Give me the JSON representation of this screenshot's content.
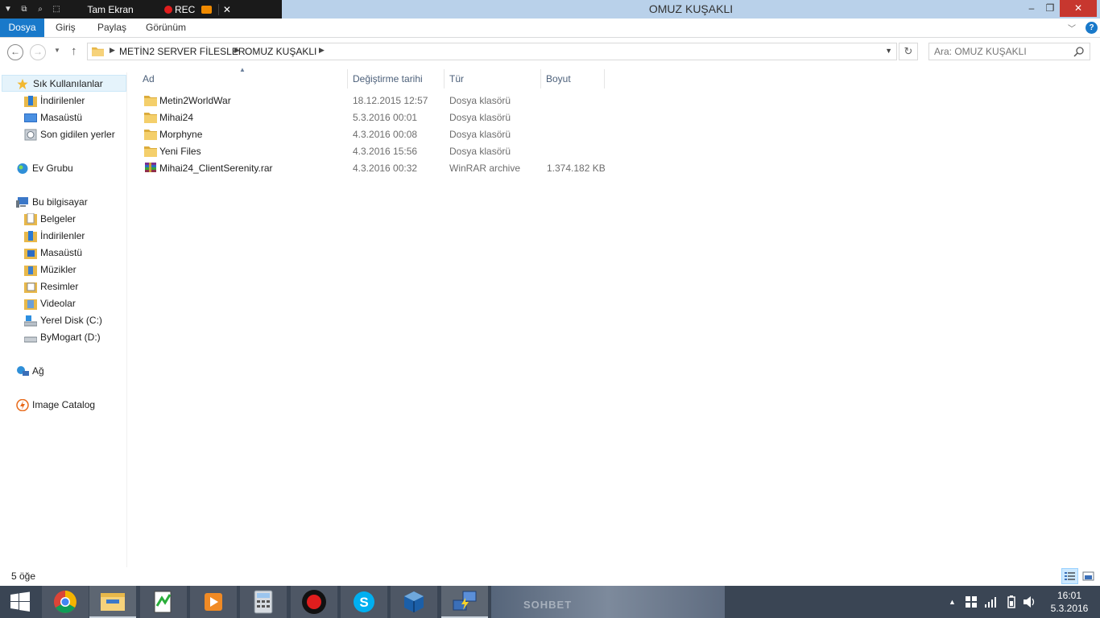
{
  "recorder": {
    "title": "Tam Ekran",
    "rec_label": "REC"
  },
  "window": {
    "title": "OMUZ KUŞAKLI",
    "minimize": "–",
    "maximize": "❐",
    "close": "✕"
  },
  "ribbon": {
    "tabs": [
      "Dosya",
      "Giriş",
      "Paylaş",
      "Görünüm"
    ]
  },
  "address": {
    "crumbs": [
      "METİN2 SERVER FİLESLER",
      "OMUZ KUŞAKLI"
    ]
  },
  "search": {
    "placeholder": "Ara: OMUZ KUŞAKLI"
  },
  "sidebar": {
    "favorites": {
      "label": "Sık Kullanılanlar",
      "items": [
        "İndirilenler",
        "Masaüstü",
        "Son gidilen yerler"
      ]
    },
    "homegroup": "Ev Grubu",
    "thispc": {
      "label": "Bu bilgisayar",
      "items": [
        "Belgeler",
        "İndirilenler",
        "Masaüstü",
        "Müzikler",
        "Resimler",
        "Videolar",
        "Yerel Disk (C:)",
        "ByMogart (D:)"
      ]
    },
    "network": "Ağ",
    "catalog": "Image Catalog"
  },
  "columns": {
    "name": "Ad",
    "date": "Değiştirme tarihi",
    "type": "Tür",
    "size": "Boyut"
  },
  "files": [
    {
      "name": "Metin2WorldWar",
      "date": "18.12.2015 12:57",
      "type": "Dosya klasörü",
      "size": "",
      "icon": "folder-icon"
    },
    {
      "name": "Mihai24",
      "date": "5.3.2016 00:01",
      "type": "Dosya klasörü",
      "size": "",
      "icon": "folder-icon"
    },
    {
      "name": "Morphyne",
      "date": "4.3.2016 00:08",
      "type": "Dosya klasörü",
      "size": "",
      "icon": "folder-icon"
    },
    {
      "name": "Yeni Files",
      "date": "4.3.2016 15:56",
      "type": "Dosya klasörü",
      "size": "",
      "icon": "folder-icon"
    },
    {
      "name": "Mihai24_ClientSerenity.rar",
      "date": "4.3.2016 00:32",
      "type": "WinRAR archive",
      "size": "1.374.182 KB",
      "icon": "winrar-icon"
    }
  ],
  "status": {
    "count": "5 öğe"
  },
  "taskbar": {
    "sohbet": "SOHBET"
  },
  "clock": {
    "time": "16:01",
    "date": "5.3.2016"
  }
}
